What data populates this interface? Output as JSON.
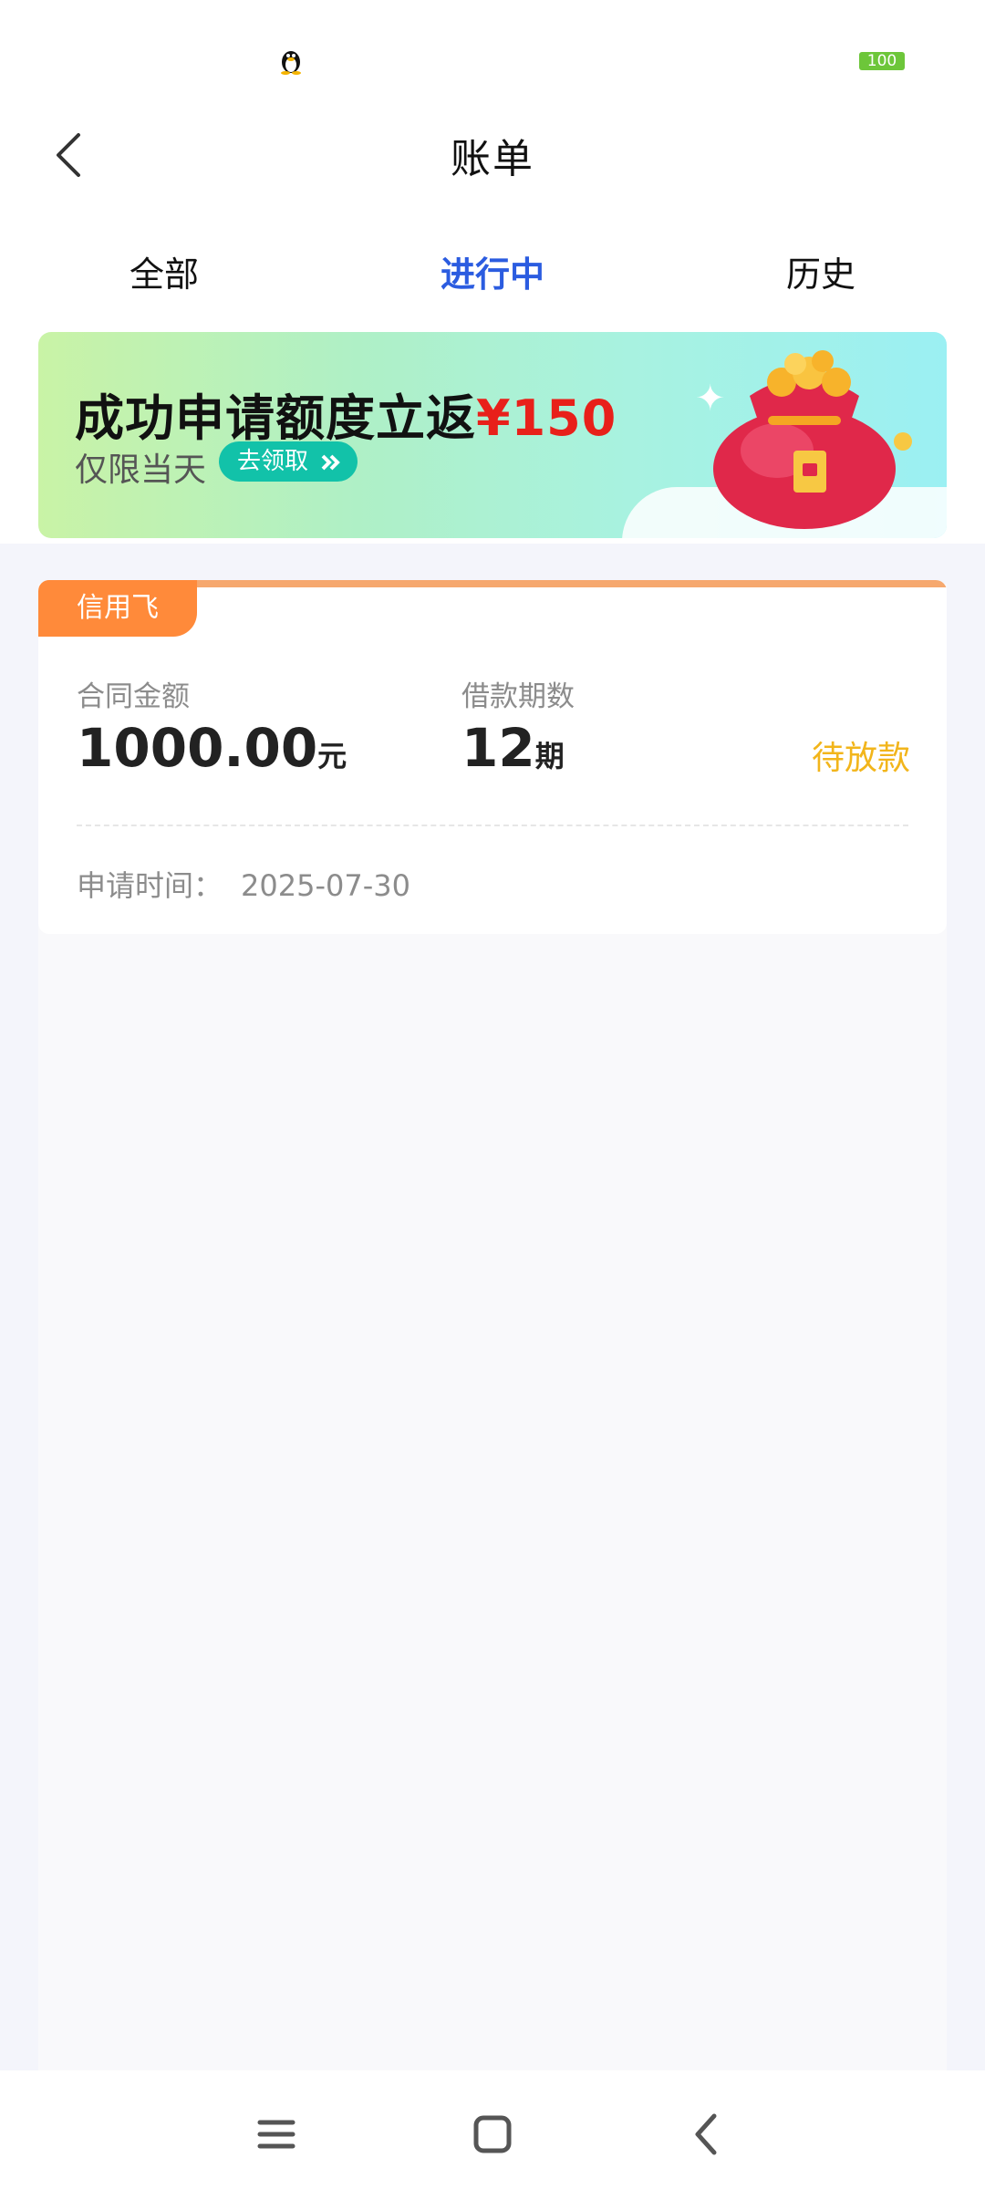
{
  "status_bar": {
    "battery_level": "100",
    "notification_icon": "qq-penguin-icon"
  },
  "header": {
    "title": "账单",
    "back_icon": "chevron-left-icon"
  },
  "tabs": [
    {
      "label": "全部",
      "active": false
    },
    {
      "label": "进行中",
      "active": true
    },
    {
      "label": "历史",
      "active": false
    }
  ],
  "banner": {
    "title_prefix": "成功申请额度立返",
    "title_amount": "¥150",
    "subtitle": "仅限当天",
    "button_label": "去领取",
    "button_icon": "double-chevron-right-icon",
    "image": "red-money-bag-icon"
  },
  "bill": {
    "provider": "信用飞",
    "amount_label": "合同金额",
    "amount_value": "1000.00",
    "amount_unit": "元",
    "term_label": "借款期数",
    "term_value": "12",
    "term_unit": "期",
    "status": "待放款",
    "apply_time_label": "申请时间：",
    "apply_time_value": "2025-07-30"
  },
  "nav_bar": {
    "menu_icon": "menu-icon",
    "home_icon": "home-square-icon",
    "back_icon": "back-triangle-icon"
  },
  "colors": {
    "accent": "#2b5ce0",
    "tag_orange": "#ff8a3a",
    "status_yellow": "#f2b51b",
    "banner_red": "#e8201a",
    "button_teal": "#12c2a9"
  }
}
